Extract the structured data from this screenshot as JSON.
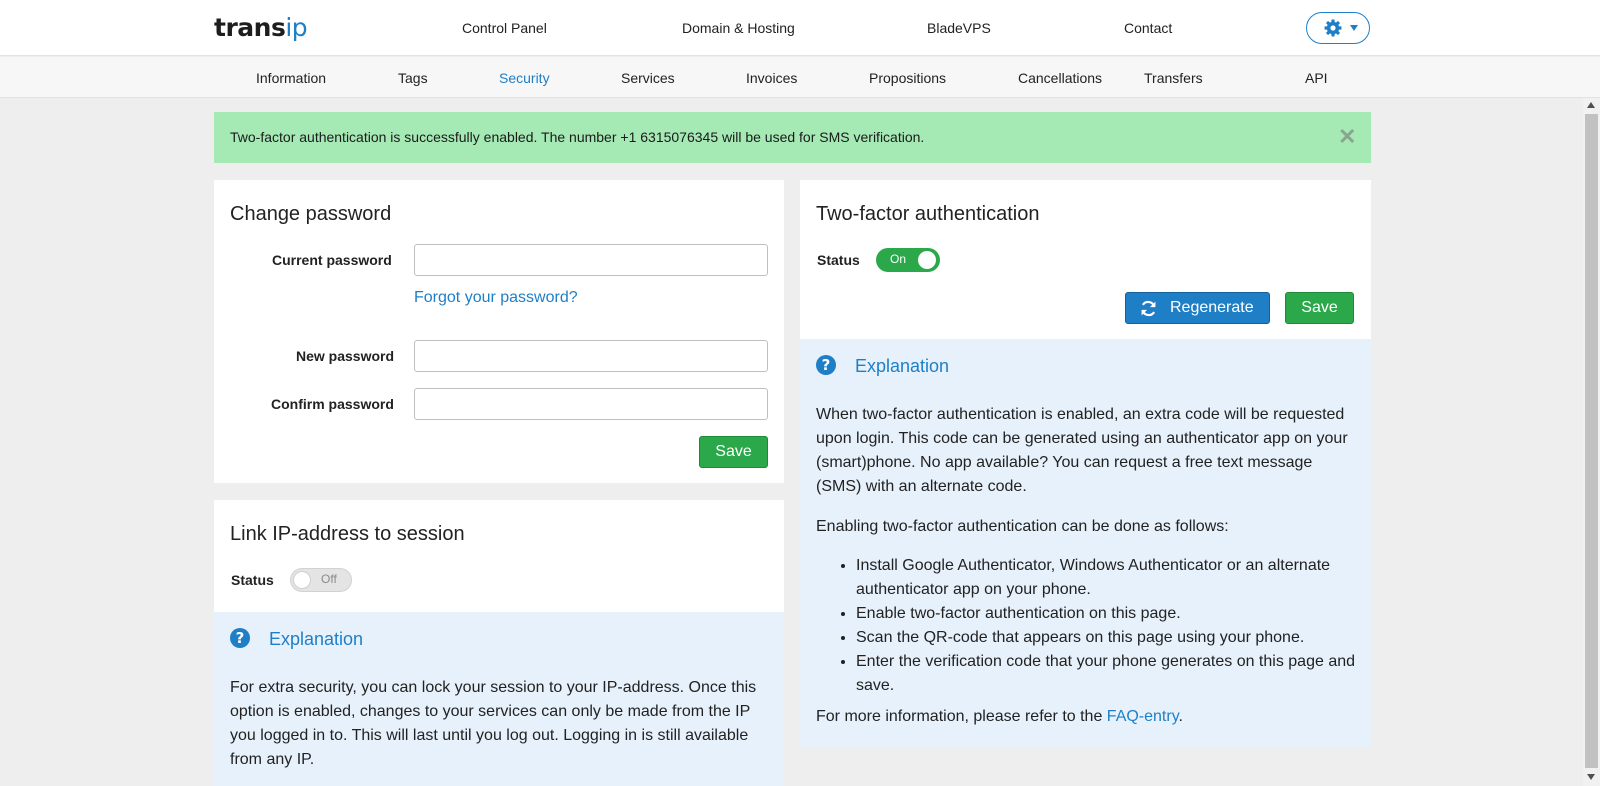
{
  "brand": {
    "part1": "trans",
    "part2": "ip"
  },
  "topnav": [
    "Control Panel",
    "Domain & Hosting",
    "BladeVPS",
    "Contact"
  ],
  "settings_icon": "gear-icon",
  "subnav": {
    "items": [
      "Information",
      "Tags",
      "Security",
      "Services",
      "Invoices",
      "Propositions",
      "Cancellations",
      "Transfers",
      "API"
    ],
    "active": "Security"
  },
  "alert": {
    "message": "Two-factor authentication is successfully enabled. The number +1 6315076345 will be used for SMS verification.",
    "close": "✕"
  },
  "change_password": {
    "title": "Change password",
    "current_label": "Current password",
    "current_value": "",
    "forgot_link": "Forgot your password?",
    "new_label": "New password",
    "new_value": "",
    "confirm_label": "Confirm password",
    "confirm_value": "",
    "save": "Save"
  },
  "link_ip": {
    "title": "Link IP-address to session",
    "status_label": "Status",
    "toggle": "Off",
    "explanation_title": "Explanation",
    "explanation_text": "For extra security, you can lock your session to your IP-address. Once this option is enabled, changes to your services can only be made from the IP you logged in to. This will last until you log out. Logging in is still available from any IP."
  },
  "two_factor": {
    "title": "Two-factor authentication",
    "status_label": "Status",
    "toggle": "On",
    "regenerate": "Regenerate",
    "save": "Save",
    "explanation_title": "Explanation",
    "para1": "When two-factor authentication is enabled, an extra code will be requested upon login. This code can be generated using an authenticator app on your (smart)phone. No app available? You can request a free text message (SMS) with an alternate code.",
    "para2": "Enabling two-factor authentication can be done as follows:",
    "steps": [
      "Install Google Authenticator, Windows Authenticator or an alternate authenticator app on your phone.",
      "Enable two-factor authentication on this page.",
      "Scan the QR-code that appears on this page using your phone.",
      "Enter the verification code that your phone generates on this page and save."
    ],
    "more_prefix": "For more information, please refer to the ",
    "more_link": "FAQ-entry",
    "more_suffix": "."
  },
  "colors": {
    "accent": "#1e7fc7",
    "success": "#2aa84a",
    "alert_bg": "#a5e9b4",
    "explanation_bg": "#e7f1fb"
  }
}
